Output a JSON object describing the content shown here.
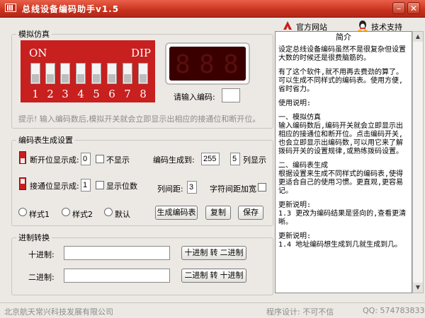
{
  "window": {
    "title": "总线设备编码助手v1.5",
    "min_glyph": "–",
    "close_glyph": "✕"
  },
  "links": {
    "website": "官方网站",
    "support": "技术支持"
  },
  "sim": {
    "legend": "模拟仿真",
    "on": "ON",
    "dip": "DIP",
    "numbers": [
      "1",
      "2",
      "3",
      "4",
      "5",
      "6",
      "7",
      "8"
    ],
    "display": [
      "8",
      "8",
      "8"
    ],
    "code_label": "请输入编码:",
    "code_value": "",
    "hint": "提示! 输入编码数后,模拟开关就会立即显示出相应的接通位和断开位。"
  },
  "table": {
    "legend": "编码表生成设置",
    "off_label": "断开位显示成:",
    "off_value": "0",
    "hide_label": "不显示",
    "gen_label": "编码生成到:",
    "gen_value": "255",
    "cols_value": "5",
    "cols_label": "列显示",
    "on_label": "接通位显示成:",
    "on_value": "1",
    "show_bits_label": "显示位数",
    "colgap_label": "列间距:",
    "colgap_value": "3",
    "charspace_label": "字符间距加宽",
    "styles": [
      "样式1",
      "样式2",
      "默认"
    ],
    "gen_button": "生成编码表",
    "copy_button": "复制",
    "save_button": "保存"
  },
  "base": {
    "legend": "进制转换",
    "dec_label": "十进制:",
    "dec_value": "",
    "bin_label": "二进制:",
    "bin_value": "",
    "to_bin_button": "十进制 转 二进制",
    "to_dec_button": "二进制 转 十进制"
  },
  "info": {
    "header": "简介",
    "paras": [
      "设定总线设备编码虽然不是很复杂但设置大数的时候还是很费脑筋的。",
      "有了这个软件,就不用再去费劲的算了。可以生成不同样式的编码表。使用方便,省时省力。",
      "使用说明:",
      "一、模拟仿真\n输入编码数后,编码开关就会立即显示出相应的接通位和断开位。点击编码开关,也会立即显示出编码数,可以用它来了解拨码开关的设置规律,或熟练拨码设置。",
      "二、编码表生成\n根据设置来生成不同样式的编码表,使得更适合自己的使用习惯。更直观,更容易记。",
      "更新说明:\n1.3 更改为编码结果是竖向的,查看更清晰。",
      "更新说明:\n1.4 地址编码想生成到几就生成到几。"
    ],
    "scroll_up": "▲",
    "scroll_down": "▼"
  },
  "status": {
    "company": "北京航天常兴科技发展有限公司",
    "designer": "程序设计: 不可不信",
    "qq": "QQ: 574783833"
  },
  "colors": {
    "dip_red": "#c81f1f",
    "title_red": "#c8321d"
  }
}
